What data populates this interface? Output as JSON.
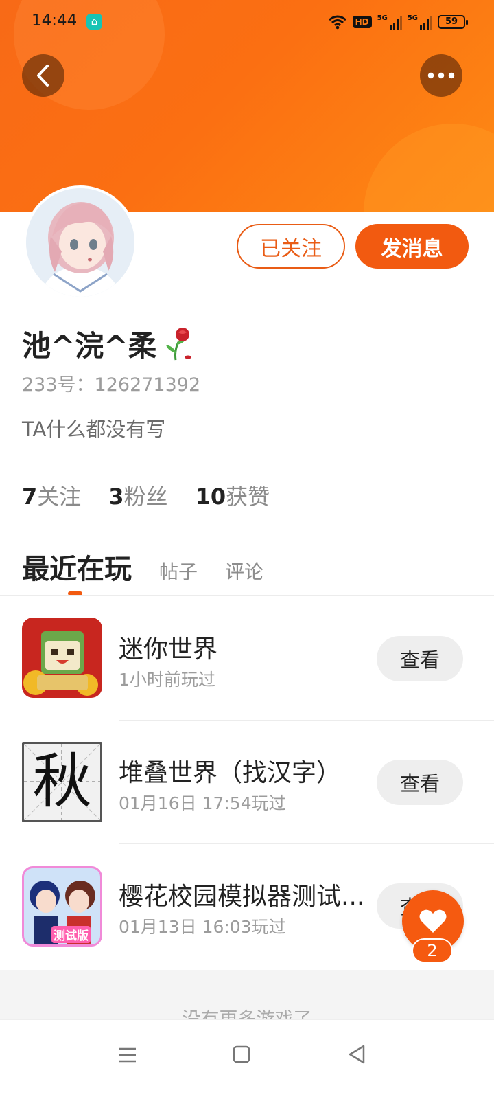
{
  "status_bar": {
    "time": "14:44",
    "app_icon": "home-app-icon",
    "hd_label": "HD",
    "sim1_label": "5G",
    "sim2_label": "5G",
    "battery": "59"
  },
  "header": {
    "back_icon": "chevron-left-icon",
    "more_icon": "more-dots-icon",
    "banner_color": "#fb6f12"
  },
  "profile": {
    "avatar": "anime-girl-avatar",
    "follow_button": "已关注",
    "message_button": "发消息",
    "username": "池^浣^柔",
    "username_emoji": "wilted-rose-icon",
    "user_id": "233号：126271392",
    "bio": "TA什么都没有写",
    "stats": [
      {
        "num": "7",
        "label": "关注"
      },
      {
        "num": "3",
        "label": "粉丝"
      },
      {
        "num": "10",
        "label": "获赞"
      }
    ]
  },
  "tabs": {
    "active": "最近在玩",
    "items": [
      "帖子",
      "评论"
    ]
  },
  "games": [
    {
      "name": "迷你世界",
      "time": "1小时前玩过",
      "button": "查看",
      "icon": "mini-world-icon"
    },
    {
      "name": "堆叠世界（找汉字）",
      "time": "01月16日 17:54玩过",
      "button": "查看",
      "icon": "chinese-character-qiu-icon",
      "icon_char": "秋"
    },
    {
      "name": "樱花校园模拟器测试...",
      "time": "01月13日 16:03玩过",
      "button": "查看",
      "icon": "sakura-school-icon",
      "icon_badge": "测试版"
    }
  ],
  "footer": {
    "no_more": "没有更多游戏了"
  },
  "fab": {
    "icon": "heart-icon",
    "count": "2"
  },
  "nav": {
    "menu_icon": "menu-icon",
    "home_icon": "square-home-icon",
    "back_icon": "triangle-back-icon"
  },
  "colors": {
    "accent": "#f25a10",
    "follow_outline": "#e95c15"
  }
}
